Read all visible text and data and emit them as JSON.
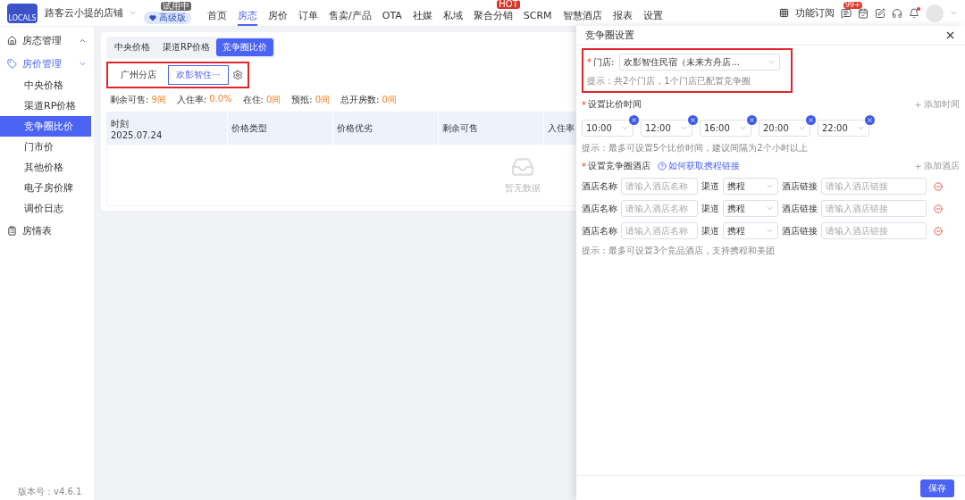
{
  "topbar": {
    "logo_text": "LOCALS",
    "store": "路客云小提的店铺",
    "plan": {
      "label": "高级版",
      "tag": "试用中"
    },
    "nav": [
      {
        "label": "首页",
        "selected": false
      },
      {
        "label": "房态",
        "selected": true
      },
      {
        "label": "房价",
        "selected": false
      },
      {
        "label": "订单",
        "selected": false
      },
      {
        "label": "售卖/产品",
        "selected": false
      },
      {
        "label": "OTA",
        "selected": false
      },
      {
        "label": "社媒",
        "selected": false
      },
      {
        "label": "私域",
        "selected": false
      },
      {
        "label": "聚合分销",
        "selected": false,
        "badge": "HOT"
      },
      {
        "label": "SCRM",
        "selected": false
      },
      {
        "label": "智慧酒店",
        "selected": false
      },
      {
        "label": "报表",
        "selected": false
      },
      {
        "label": "设置",
        "selected": false
      }
    ],
    "subscribe": "功能订阅",
    "message_badge": "99+"
  },
  "sidebar": {
    "groups": [
      {
        "label": "房态管理",
        "expanded": false,
        "selected": false
      },
      {
        "label": "房价管理",
        "expanded": true,
        "selected": true,
        "children": [
          {
            "label": "中央价格",
            "selected": false
          },
          {
            "label": "渠道RP价格",
            "selected": false
          },
          {
            "label": "竞争圈比价",
            "selected": true
          },
          {
            "label": "门市价",
            "selected": false
          },
          {
            "label": "其他价格",
            "selected": false
          },
          {
            "label": "电子房价牌",
            "selected": false
          },
          {
            "label": "调价日志",
            "selected": false
          }
        ]
      },
      {
        "label": "房情表",
        "selected": false
      }
    ],
    "version": "版本号：v4.6.1"
  },
  "main": {
    "tabs": [
      {
        "label": "中央价格",
        "selected": false
      },
      {
        "label": "渠道RP价格",
        "selected": false
      },
      {
        "label": "竞争圈比价",
        "selected": true
      }
    ],
    "stores": [
      {
        "label": "广州分店",
        "selected": false
      },
      {
        "label": "欢影智住···",
        "selected": true
      }
    ],
    "stats": [
      {
        "label": "剩余可售:",
        "value": "9间"
      },
      {
        "label": "入住率:",
        "value": "0.0%"
      },
      {
        "label": "在住:",
        "value": "0间"
      },
      {
        "label": "预抵:",
        "value": "0间"
      },
      {
        "label": "总开房数:",
        "value": "0间"
      }
    ],
    "table": {
      "columns": [
        {
          "label": "时刻",
          "sub": "2025.07.24"
        },
        {
          "label": "价格类型"
        },
        {
          "label": "价格优劣"
        },
        {
          "label": "剩余可售"
        },
        {
          "label": "入住率"
        }
      ],
      "empty": "暂无数据"
    }
  },
  "drawer": {
    "title": "竞争圈设置",
    "store_field": {
      "mark": "*",
      "label": "门店:",
      "value": "欢影智住民宿（未来方舟店...",
      "hint": "提示：共2个门店，1个门店已配置竞争圈"
    },
    "times": {
      "mark": "*",
      "label": "设置比价时间",
      "add": "添加时间",
      "values": [
        "10:00",
        "12:00",
        "16:00",
        "20:00",
        "22:00"
      ],
      "hint": "提示：最多可设置5个比价时间，建议间隔为2个小时以上"
    },
    "hotels": {
      "mark": "*",
      "label": "设置竞争圈酒店",
      "help": "如何获取携程链接",
      "add": "添加酒店",
      "rows": [
        {
          "name_label": "酒店名称",
          "name_placeholder": "请输入酒店名称",
          "channel_label": "渠道",
          "channel": "携程",
          "link_label": "酒店链接",
          "link_placeholder": "请输入酒店链接"
        },
        {
          "name_label": "酒店名称",
          "name_placeholder": "请输入酒店名称",
          "channel_label": "渠道",
          "channel": "携程",
          "link_label": "酒店链接",
          "link_placeholder": "请输入酒店链接"
        },
        {
          "name_label": "酒店名称",
          "name_placeholder": "请输入酒店名称",
          "channel_label": "渠道",
          "channel": "携程",
          "link_label": "酒店链接",
          "link_placeholder": "请输入酒店链接"
        }
      ],
      "hint": "提示：最多可设置3个竞品酒店，支持携程和美团"
    },
    "save": "保存"
  }
}
